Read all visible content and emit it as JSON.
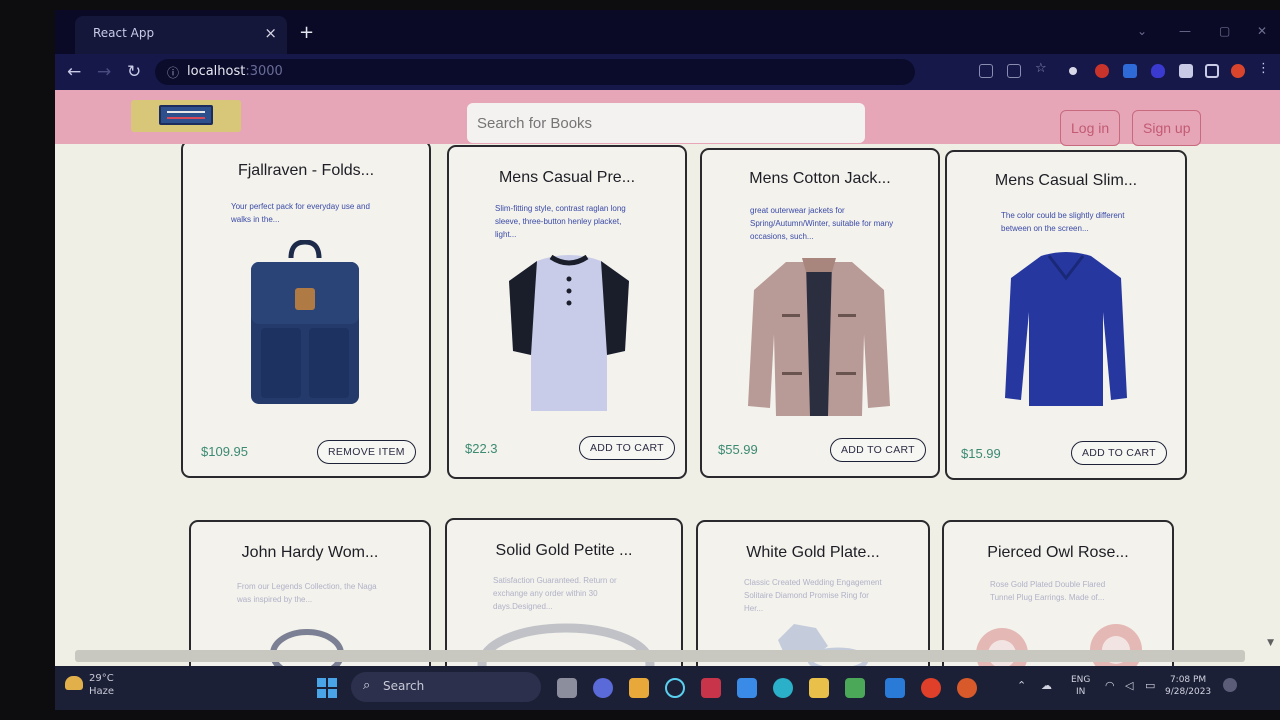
{
  "browser": {
    "tab_title": "React App",
    "tab_close": "×",
    "new_tab": "+",
    "url_host": "localhost",
    "url_port": ":3000"
  },
  "navbar": {
    "search_placeholder": "Search for Books",
    "login_label": "Log in",
    "signup_label": "Sign up"
  },
  "products": [
    {
      "title": "Fjallraven - Folds...",
      "desc": "Your perfect pack for everyday use and walks in the...",
      "price": "$109.95",
      "button": "REMOVE ITEM",
      "image": "backpack-image"
    },
    {
      "title": "Mens Casual Pre...",
      "desc": "Slim-fitting style, contrast raglan long sleeve, three-button henley placket, light...",
      "price": "$22.3",
      "button": "ADD TO CART",
      "image": "henley-shirt-image"
    },
    {
      "title": "Mens Cotton Jack...",
      "desc": "great outerwear jackets for Spring/Autumn/Winter, suitable for many occasions, such...",
      "price": "$55.99",
      "button": "ADD TO CART",
      "image": "jacket-image"
    },
    {
      "title": "Mens Casual Slim...",
      "desc": "The color could be slightly different between on the screen...",
      "price": "$15.99",
      "button": "ADD TO CART",
      "image": "sweater-image"
    },
    {
      "title": "John Hardy Wom...",
      "desc": "From our Legends Collection, the Naga was inspired by the...",
      "image": "bracelet-image"
    },
    {
      "title": "Solid Gold Petite ...",
      "desc": "Satisfaction Guaranteed. Return or exchange any order within 30 days.Designed...",
      "image": "ring-image"
    },
    {
      "title": "White Gold Plate...",
      "desc": "Classic Created Wedding Engagement Solitaire Diamond Promise Ring for Her...",
      "image": "diamond-ring-image"
    },
    {
      "title": "Pierced Owl Rose...",
      "desc": "Rose Gold Plated Double Flared Tunnel Plug Earrings. Made of...",
      "image": "plug-earrings-image"
    }
  ],
  "taskbar": {
    "temperature": "29°C",
    "weather": "Haze",
    "search_label": "Search",
    "lang": "ENG",
    "region": "IN",
    "time": "7:08 PM",
    "date": "9/28/2023"
  }
}
